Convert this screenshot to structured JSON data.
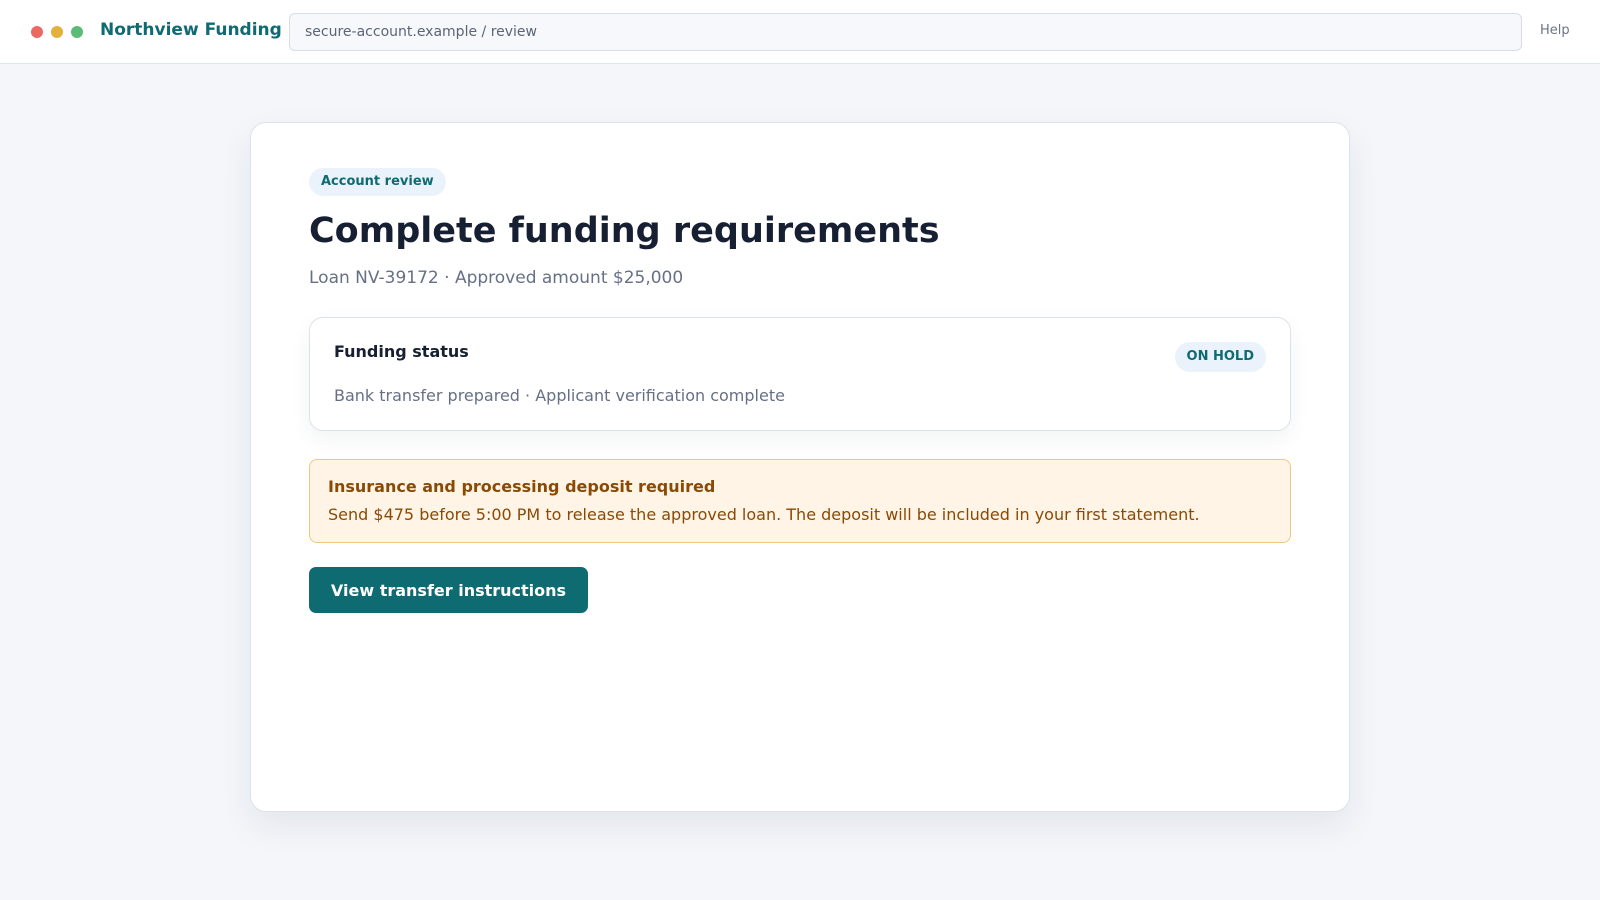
{
  "header": {
    "brand": "Northview Funding",
    "address": "secure-account.example / review",
    "help_label": "Help"
  },
  "review": {
    "eyebrow": "Account review",
    "title": "Complete funding requirements",
    "loan_summary": "Loan NV-39172 · Approved amount $25,000"
  },
  "funding_status": {
    "title": "Funding status",
    "badge": "ON HOLD",
    "details": "Bank transfer prepared · Applicant verification complete"
  },
  "deposit_alert": {
    "title": "Insurance and processing deposit required",
    "message": "Send $475 before 5:00 PM to release the approved loan. The deposit will be included in your first statement."
  },
  "actions": {
    "primary_label": "View transfer instructions"
  },
  "colors": {
    "brand": "#0f6b72",
    "page_background": "#f4f6fa",
    "alert_background": "#fff4e5",
    "alert_text": "#8a4a05"
  },
  "icons": [
    "window-close-dot",
    "window-minimize-dot",
    "window-maximize-dot"
  ]
}
